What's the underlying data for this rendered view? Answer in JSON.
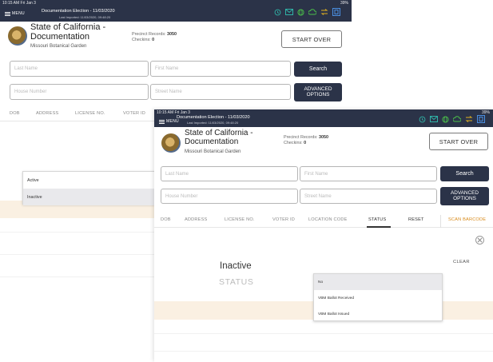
{
  "back": {
    "status_bar": {
      "time": "10:15 AM  Fri Jan 3",
      "battery": "39%"
    },
    "nav": {
      "menu_label": "MENU",
      "election": "Documentation Election - 11/03/2020",
      "last_imported": "Last Imported: 11/03/2020, 09:48:20",
      "icons": [
        "history-icon",
        "mail-icon",
        "globe-icon",
        "cloud-upload-icon",
        "sync-icon",
        "device-icon"
      ]
    },
    "header": {
      "title": "State of California - Documentation",
      "location": "Missouri Botanical Garden",
      "precinct_label": "Precinct Records:",
      "precinct_value": "3050",
      "checkins_label": "Checkins:",
      "checkins_value": "0",
      "start_over": "START OVER"
    },
    "search": {
      "last_name_placeholder": "Last Name",
      "first_name_placeholder": "First Name",
      "house_number_placeholder": "House Number",
      "street_name_placeholder": "Street Name",
      "search_button": "Search",
      "advanced_button": "ADVANCED OPTIONS"
    },
    "columns": [
      "DOB",
      "ADDRESS",
      "LICENSE NO.",
      "VOTER ID"
    ],
    "dropdown": {
      "options": [
        "Active",
        "Inactive"
      ],
      "highlighted": "Inactive"
    }
  },
  "front": {
    "status_bar": {
      "time": "10:15 AM  Fri Jan 3",
      "battery": "39%"
    },
    "nav": {
      "menu_label": "MENU",
      "election": "Documentation Election - 11/03/2020",
      "last_imported": "Last Imported: 11/03/2020, 09:48:20",
      "icons": [
        "history-icon",
        "mail-icon",
        "globe-icon",
        "cloud-upload-icon",
        "sync-icon",
        "device-icon"
      ]
    },
    "header": {
      "title": "State of California - Documentation",
      "location": "Missouri Botanical Garden",
      "precinct_label": "Precinct Records:",
      "precinct_value": "3050",
      "checkins_label": "Checkins:",
      "checkins_value": "0",
      "start_over": "START OVER"
    },
    "search": {
      "last_name_placeholder": "Last Name",
      "first_name_placeholder": "First Name",
      "house_number_placeholder": "House Number",
      "street_name_placeholder": "Street Name",
      "search_button": "Search",
      "advanced_button": "ADVANCED OPTIONS"
    },
    "columns": [
      "DOB",
      "ADDRESS",
      "LICENSE NO.",
      "VOTER ID",
      "LOCATION CODE",
      "STATUS",
      "RESET",
      "SCAN BARCODE"
    ],
    "active_column": "STATUS",
    "filter": {
      "value": "Inactive",
      "label": "STATUS",
      "clear": "CLEAR"
    },
    "dropdown": {
      "options": [
        "No",
        "VBM Ballot Received",
        "VBM Ballot Issued"
      ],
      "highlighted": "No"
    }
  },
  "colors": {
    "nav_bg": "#2b3348",
    "accent_orange": "#d88a1a",
    "beige_band": "#faf0e2"
  }
}
